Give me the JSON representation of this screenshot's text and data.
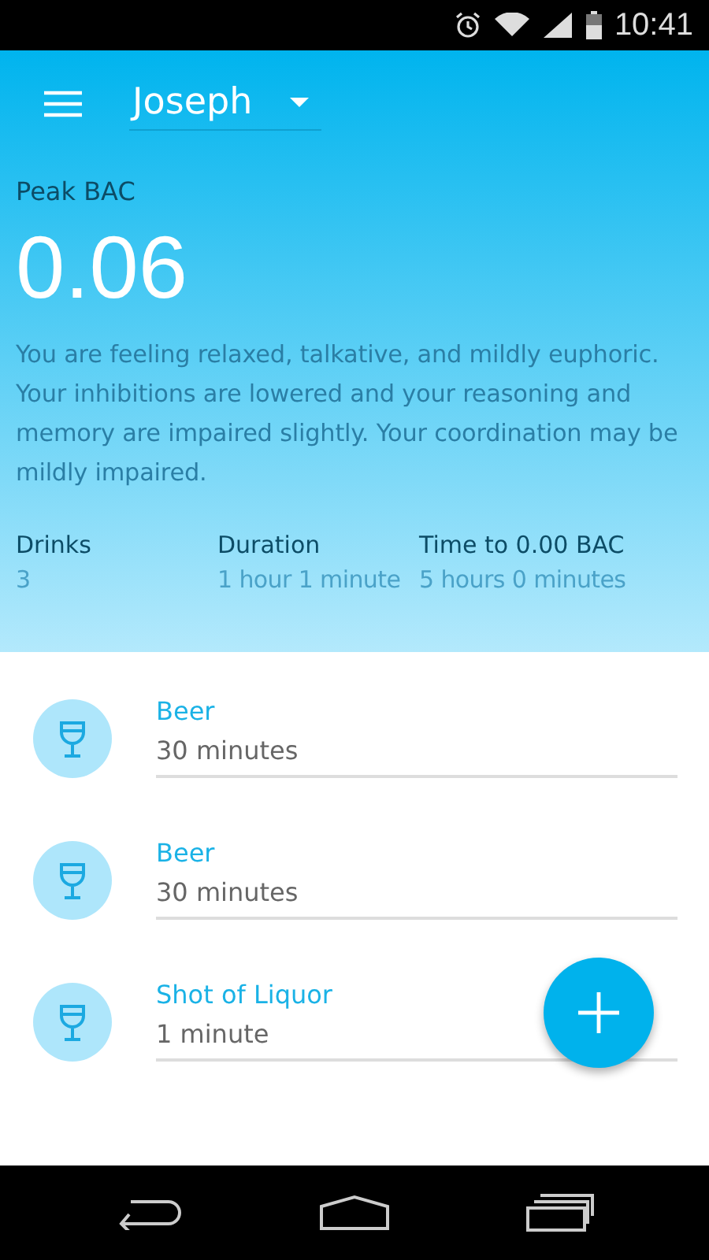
{
  "status_bar": {
    "time": "10:41"
  },
  "app_bar": {
    "profile": "Joseph"
  },
  "summary": {
    "label": "Peak BAC",
    "value": "0.06",
    "description": "You are feeling relaxed, talkative, and mildly euphoric. Your inhibitions are lowered and your reasoning and memory are impaired slightly. Your coordination may be mildly impaired.",
    "stats": [
      {
        "label": "Drinks",
        "value": "3"
      },
      {
        "label": "Duration",
        "value": "1 hour 1 minute"
      },
      {
        "label": "Time to 0.00 BAC",
        "value": "5 hours 0 minutes"
      }
    ]
  },
  "drinks": [
    {
      "name": "Beer",
      "time": "30 minutes"
    },
    {
      "name": "Beer",
      "time": "30 minutes"
    },
    {
      "name": "Shot of Liquor",
      "time": "1 minute"
    }
  ]
}
